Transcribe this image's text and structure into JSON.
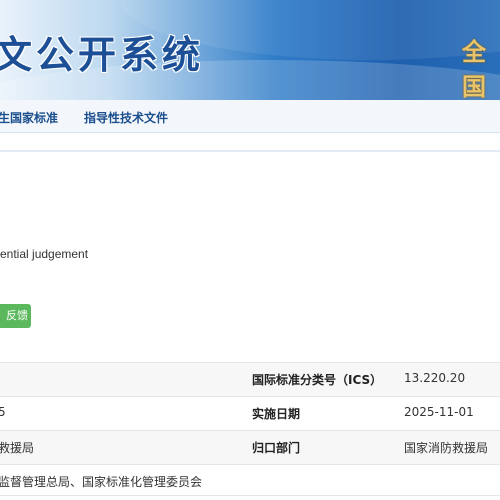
{
  "header": {
    "title": "文公开系统",
    "emblem_text": "全国"
  },
  "nav": {
    "items": [
      {
        "label": "生国家标准"
      },
      {
        "label": "指导性技术文件"
      }
    ]
  },
  "standard": {
    "english_title_fragment": "ential judgement",
    "feedback_label": "反馈"
  },
  "info_table": {
    "rows": [
      {
        "left": "",
        "label": "国际标准分类号（ICS）",
        "value": "13.220.20"
      },
      {
        "left": "5",
        "label": "实施日期",
        "value": "2025-11-01"
      },
      {
        "left": "救援局",
        "label": "归口部门",
        "value": "国家消防救援局"
      },
      {
        "left": "监督管理总局、国家标准化管理委员会",
        "label": "",
        "value": ""
      }
    ]
  },
  "colors": {
    "banner_blue": "#1d5fae",
    "nav_text": "#1b4e8c",
    "feedback_green": "#5cb85c"
  }
}
